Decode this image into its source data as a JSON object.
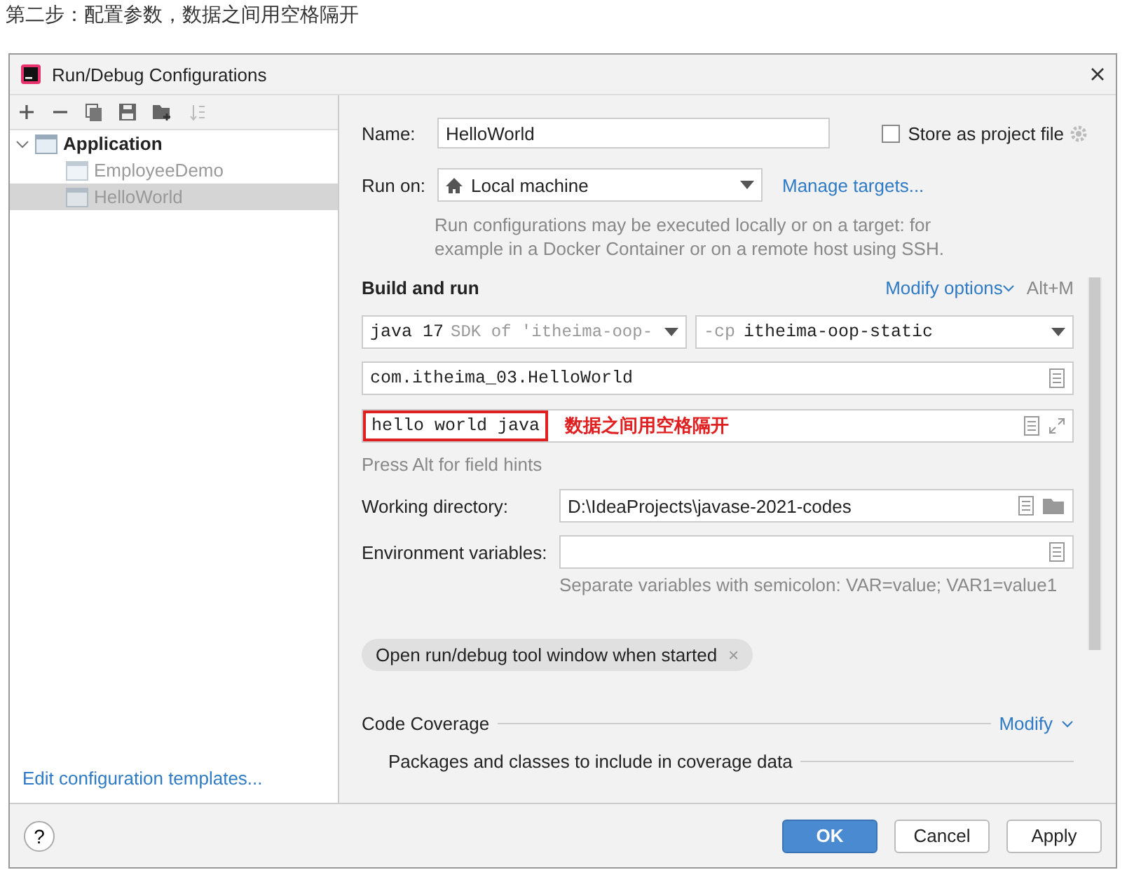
{
  "heading": "第二步：配置参数，数据之间用空格隔开",
  "window": {
    "title": "Run/Debug Configurations"
  },
  "tree": [
    {
      "label": "Application",
      "selected": false,
      "expanded": true,
      "children": [
        {
          "label": "EmployeeDemo",
          "selected": false
        },
        {
          "label": "HelloWorld",
          "selected": true
        }
      ]
    }
  ],
  "edit_templates_link": "Edit configuration templates...",
  "form": {
    "name_label": "Name:",
    "name_value": "HelloWorld",
    "store_as_project_file": {
      "label": "Store as project file",
      "checked": false
    },
    "run_on_label": "Run on:",
    "run_on_value": "Local machine",
    "manage_targets": "Manage targets...",
    "run_on_hint": "Run configurations may be executed locally or on a target: for example in a Docker Container or on a remote host using SSH."
  },
  "build_and_run": {
    "title": "Build and run",
    "modify_options": "Modify options",
    "shortcut": "Alt+M",
    "jdk": {
      "main": "java 17",
      "detail": "SDK of 'itheima-oop-"
    },
    "classpath": {
      "flag": "-cp",
      "module": "itheima-oop-static"
    },
    "main_class": "com.itheima_03.HelloWorld",
    "program_arguments": "hello world java",
    "annotation": "数据之间用空格隔开",
    "field_hint": "Press Alt for field hints",
    "working_directory_label": "Working directory:",
    "working_directory": "D:\\IdeaProjects\\javase-2021-codes",
    "env_label": "Environment variables:",
    "env_hint": "Separate variables with semicolon: VAR=value; VAR1=value1",
    "option_chip": {
      "label": "Open run/debug tool window when started",
      "remove": "×"
    }
  },
  "code_coverage": {
    "title": "Code Coverage",
    "modify": "Modify",
    "packages": "Packages and classes to include in coverage data"
  },
  "help": "?",
  "buttons": [
    {
      "label": "OK",
      "kind": "primary"
    },
    {
      "label": "Cancel",
      "kind": "secondary"
    },
    {
      "label": "Apply",
      "kind": "secondary"
    }
  ]
}
